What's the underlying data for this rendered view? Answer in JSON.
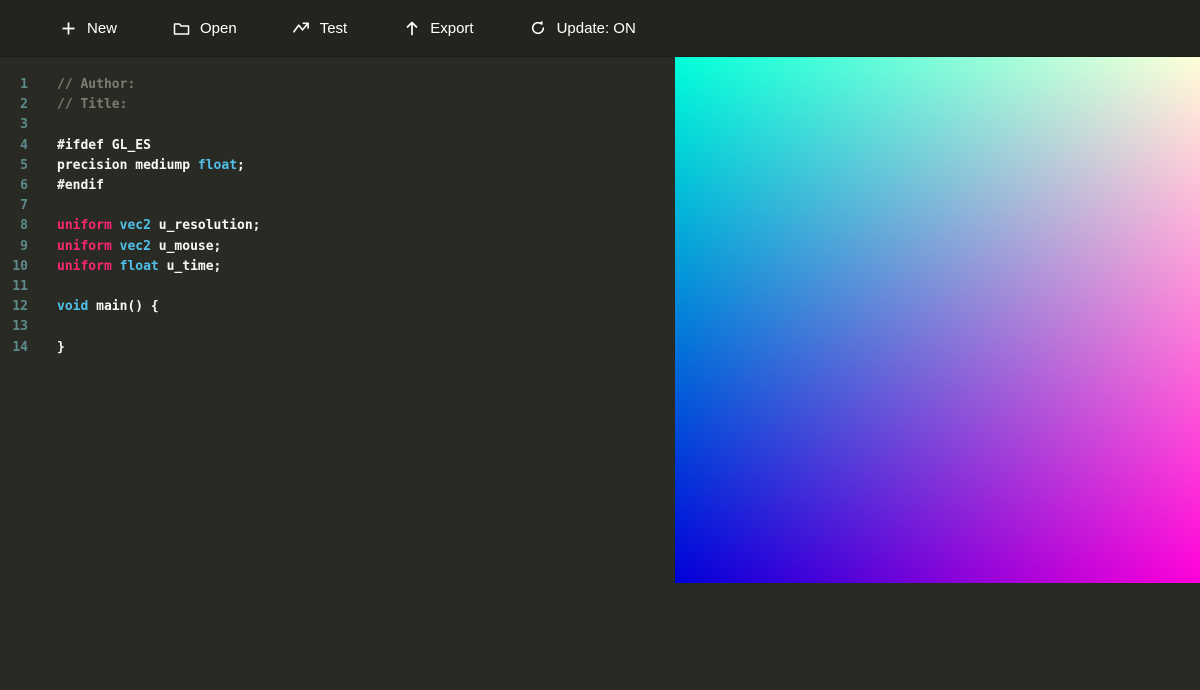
{
  "toolbar": {
    "buttons": [
      {
        "id": "new",
        "icon": "plus-icon",
        "label": "New"
      },
      {
        "id": "open",
        "icon": "folder-icon",
        "label": "Open"
      },
      {
        "id": "test",
        "icon": "graph-icon",
        "label": "Test"
      },
      {
        "id": "export",
        "icon": "arrow-up-icon",
        "label": "Export"
      },
      {
        "id": "update",
        "icon": "refresh-icon",
        "label": "Update: ON"
      }
    ]
  },
  "editor": {
    "language": "glsl",
    "lines": [
      {
        "num": 1,
        "tokens": [
          {
            "t": "// Author:",
            "c": "comment"
          }
        ]
      },
      {
        "num": 2,
        "tokens": [
          {
            "t": "// Title:",
            "c": "comment"
          }
        ]
      },
      {
        "num": 3,
        "tokens": []
      },
      {
        "num": 4,
        "tokens": [
          {
            "t": "#ifdef GL_ES",
            "c": "preproc"
          }
        ]
      },
      {
        "num": 5,
        "tokens": [
          {
            "t": "precision mediump ",
            "c": "plain"
          },
          {
            "t": "float",
            "c": "type"
          },
          {
            "t": ";",
            "c": "plain"
          }
        ]
      },
      {
        "num": 6,
        "tokens": [
          {
            "t": "#endif",
            "c": "preproc"
          }
        ]
      },
      {
        "num": 7,
        "tokens": []
      },
      {
        "num": 8,
        "tokens": [
          {
            "t": "uniform",
            "c": "keyword"
          },
          {
            "t": " ",
            "c": "plain"
          },
          {
            "t": "vec2",
            "c": "type"
          },
          {
            "t": " u_resolution;",
            "c": "plain"
          }
        ]
      },
      {
        "num": 9,
        "tokens": [
          {
            "t": "uniform",
            "c": "keyword"
          },
          {
            "t": " ",
            "c": "plain"
          },
          {
            "t": "vec2",
            "c": "type"
          },
          {
            "t": " u_mouse;",
            "c": "plain"
          }
        ]
      },
      {
        "num": 10,
        "tokens": [
          {
            "t": "uniform",
            "c": "keyword"
          },
          {
            "t": " ",
            "c": "plain"
          },
          {
            "t": "float",
            "c": "type"
          },
          {
            "t": " u_time;",
            "c": "plain"
          }
        ]
      },
      {
        "num": 11,
        "tokens": []
      },
      {
        "num": 12,
        "tokens": [
          {
            "t": "void",
            "c": "type"
          },
          {
            "t": " main() {",
            "c": "plain"
          }
        ]
      },
      {
        "num": 13,
        "tokens": []
      },
      {
        "num": 14,
        "tokens": [
          {
            "t": "}",
            "c": "plain"
          }
        ]
      }
    ]
  },
  "preview": {
    "corner_colors": {
      "top_left": "#00ffd9",
      "top_right": "#ffffd9",
      "bottom_left": "#0000d9",
      "bottom_right": "#ff00d9"
    }
  },
  "colors": {
    "background": "#2a2a25",
    "toolbar_background": "#232320",
    "text": "#f8f8f2",
    "comment": "#7d7b72",
    "keyword": "#f92672",
    "type": "#4fc1e9",
    "line_number": "#5c8b8b"
  }
}
